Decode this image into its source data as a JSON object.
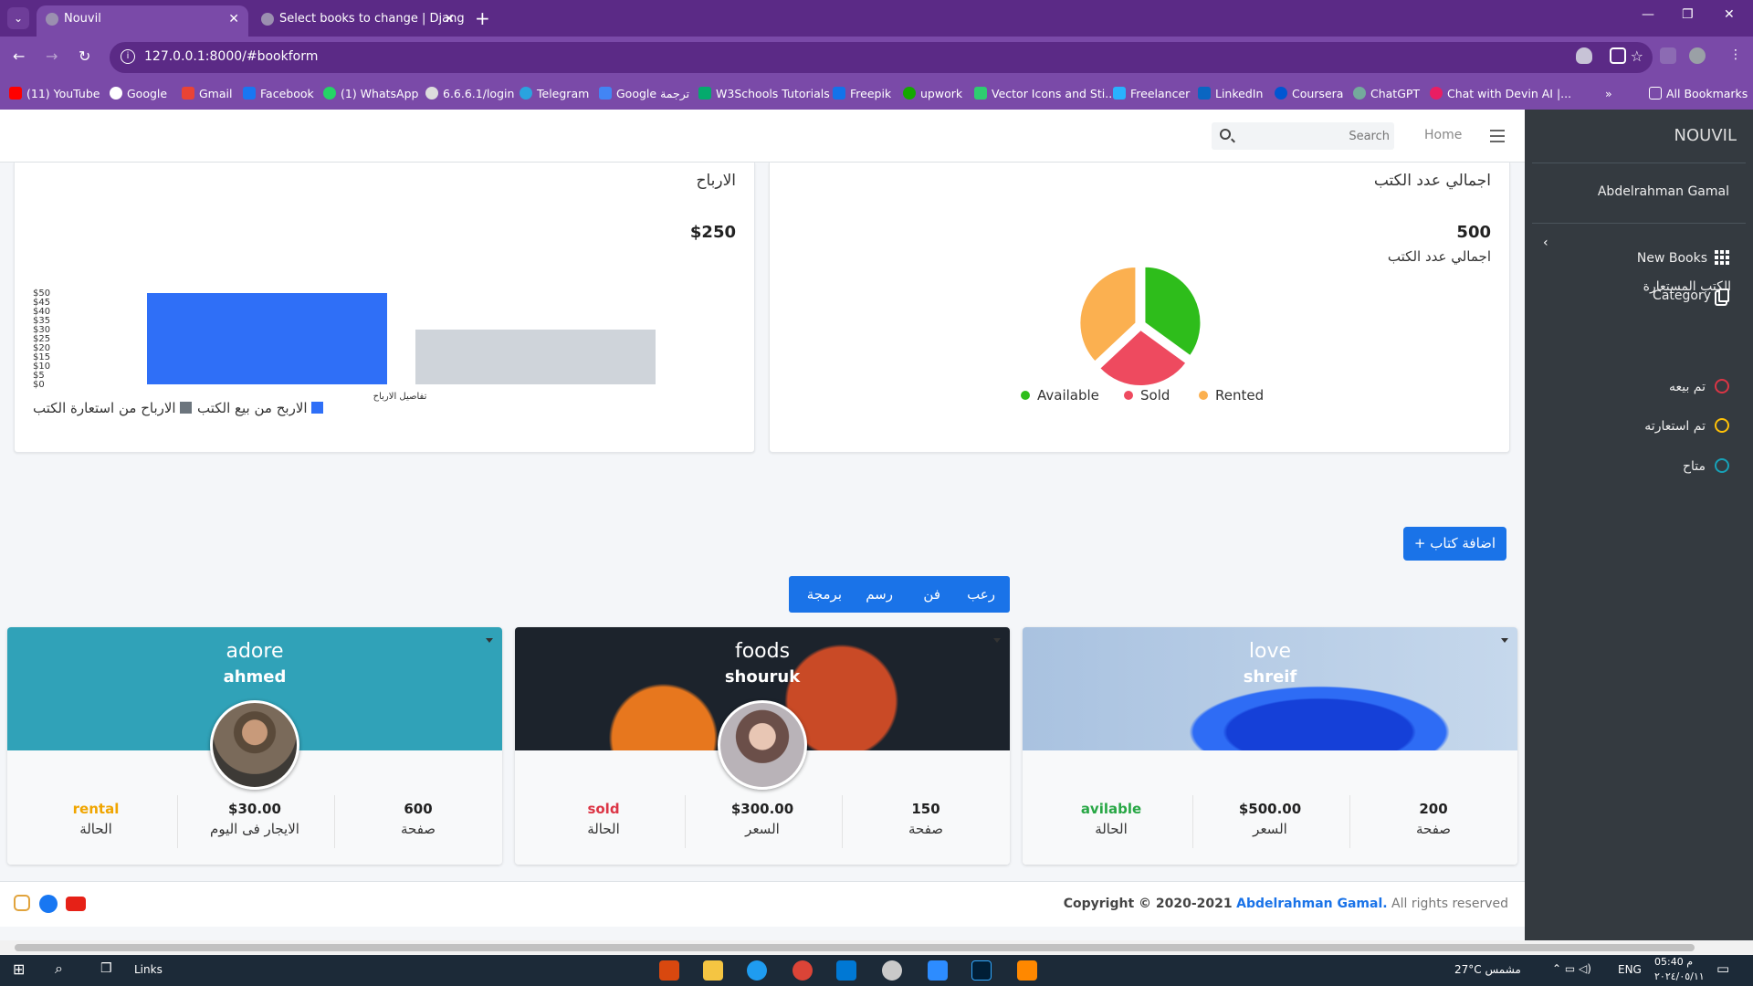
{
  "browser": {
    "tabs": [
      {
        "title": "Nouvil",
        "active": true
      },
      {
        "title": "Select books to change | Djang",
        "active": false
      }
    ],
    "url": "127.0.0.1:8000/#bookform",
    "bookmarks": [
      "(11) YouTube",
      "Google",
      "Gmail",
      "Facebook",
      "(1) WhatsApp",
      "6.6.6.1/login",
      "Telegram",
      "Google ترجمة",
      "W3Schools Tutorials",
      "Freepik",
      "upwork",
      "Vector Icons and Sti...",
      "Freelancer",
      "LinkedIn",
      "Coursera",
      "ChatGPT",
      "Chat with Devin AI |..."
    ],
    "all_bookmarks": "All Bookmarks"
  },
  "topnav": {
    "search_placeholder": "Search",
    "home": "Home"
  },
  "sidebar": {
    "brand": "NOUVIL",
    "user": "Abdelrahman Gamal",
    "items": [
      {
        "label": "New Books",
        "icon": "grid-icon"
      },
      {
        "label": "Category",
        "icon": "copy-icon"
      }
    ],
    "borrowed_header": "الكتب المستعارة",
    "statuses": [
      {
        "label": "تم بيعه",
        "color": "#dc3545"
      },
      {
        "label": "تم استعارته",
        "color": "#ffc107"
      },
      {
        "label": "متاح",
        "color": "#17a2b8"
      }
    ]
  },
  "books_card": {
    "title": "اجمالي عدد الكتب",
    "total": "500",
    "subtitle": "اجمالي عدد الكتب",
    "chart_data": {
      "type": "pie",
      "categories": [
        "Available",
        "Sold",
        "Rented"
      ],
      "values": [
        35,
        28,
        37
      ],
      "colors": [
        "#2ebd1b",
        "#ee4a5f",
        "#fbb050"
      ],
      "legend": "bottom"
    }
  },
  "profit_card": {
    "title": "الارباح",
    "total": "$250",
    "chart_data": {
      "type": "bar",
      "categories": [
        "تفاصيل الارباح"
      ],
      "series": [
        {
          "name": "الاربح من بيع الكتب",
          "values": [
            50
          ],
          "color": "#2f6ff7"
        },
        {
          "name": "الارباح من استعارة الكتب",
          "values": [
            30
          ],
          "color": "#cfd4da"
        }
      ],
      "yticks": [
        "$50",
        "$45",
        "$40",
        "$35",
        "$30",
        "$25",
        "$20",
        "$15",
        "$10",
        "$5",
        "$0"
      ],
      "ylim": [
        0,
        50
      ],
      "xlabel": "تفاصيل الارباح",
      "legend_colors": [
        "#2f6ff7",
        "#6c757d"
      ]
    }
  },
  "actions": {
    "add_book": "+ اضافة كتاب",
    "filters": [
      "رعب",
      "فن",
      "رسم",
      "برمجة"
    ]
  },
  "books": [
    {
      "title": "adore",
      "author": "ahmed",
      "pages": "600",
      "pages_label": "صفحة",
      "price": "$30.00",
      "price_label": "الايجار فى اليوم",
      "status": "rental",
      "status_label": "الحالة",
      "status_color": "#f0a500",
      "header_color": "#30a2b8"
    },
    {
      "title": "foods",
      "author": "shouruk",
      "pages": "150",
      "pages_label": "صفحة",
      "price": "$300.00",
      "price_label": "السعر",
      "status": "sold",
      "status_label": "الحالة",
      "status_color": "#dc3545",
      "header_color": "#1c232c"
    },
    {
      "title": "love",
      "author": "shreif",
      "pages": "200",
      "pages_label": "صفحة",
      "price": "$500.00",
      "price_label": "السعر",
      "status": "avilable",
      "status_label": "الحالة",
      "status_color": "#28a745",
      "header_color": "#9ab8dc"
    }
  ],
  "footer": {
    "copyright_prefix": "Copyright © 2020-2021",
    "author": "Abdelrahman Gamal.",
    "rights": "All rights reserved"
  },
  "taskbar": {
    "links": "Links",
    "weather": "27°C مشمس",
    "lang": "ENG",
    "time": "05:40 م",
    "date": "٢٠٢٤/٠٥/١١"
  }
}
